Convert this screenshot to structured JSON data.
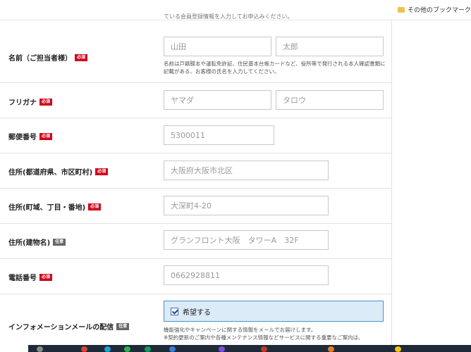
{
  "bookmarks": {
    "other": "その他のブックマーク"
  },
  "top_note": "ている会員登録情報を入力してお申込みください。",
  "fields": {
    "name": {
      "label": "名前（ご担当者様）",
      "badge": "必須",
      "last_placeholder": "山田",
      "first_placeholder": "太郎",
      "note": "名前は戸籍謄本や運転免許証、住民基本台帳カードなど、役所等で発行される本人確認書類に記載がある、お客様の氏名を入力してください。"
    },
    "kana": {
      "label": "フリガナ",
      "badge": "必須",
      "last_placeholder": "ヤマダ",
      "first_placeholder": "タロウ"
    },
    "postal": {
      "label": "郵便番号",
      "badge": "必須",
      "placeholder": "5300011"
    },
    "addr1": {
      "label": "住所(都道府県、市区町村)",
      "badge": "必須",
      "placeholder": "大阪府大阪市北区"
    },
    "addr2": {
      "label": "住所(町域、丁目・番地)",
      "badge": "必須",
      "placeholder": "大深町4-20"
    },
    "addr3": {
      "label": "住所(建物名)",
      "badge": "任意",
      "placeholder": "グランフロント大阪　タワーA　32F"
    },
    "phone": {
      "label": "電話番号",
      "badge": "必須",
      "placeholder": "0662928811"
    },
    "mail": {
      "label": "インフォメーションメールの配信",
      "badge": "任意",
      "checkbox_label": "希望する",
      "checked": true,
      "note1": "機能強化やキャンペーンに関する情報をメールでお届けします。",
      "note2": "※契約更新のご案内や各種メンテナンス情報などサービスに関する重要なご案内は、"
    }
  },
  "colors": {
    "required": "#d0021b",
    "optional": "#666666",
    "checkbox_bg": "#dcebf8"
  }
}
